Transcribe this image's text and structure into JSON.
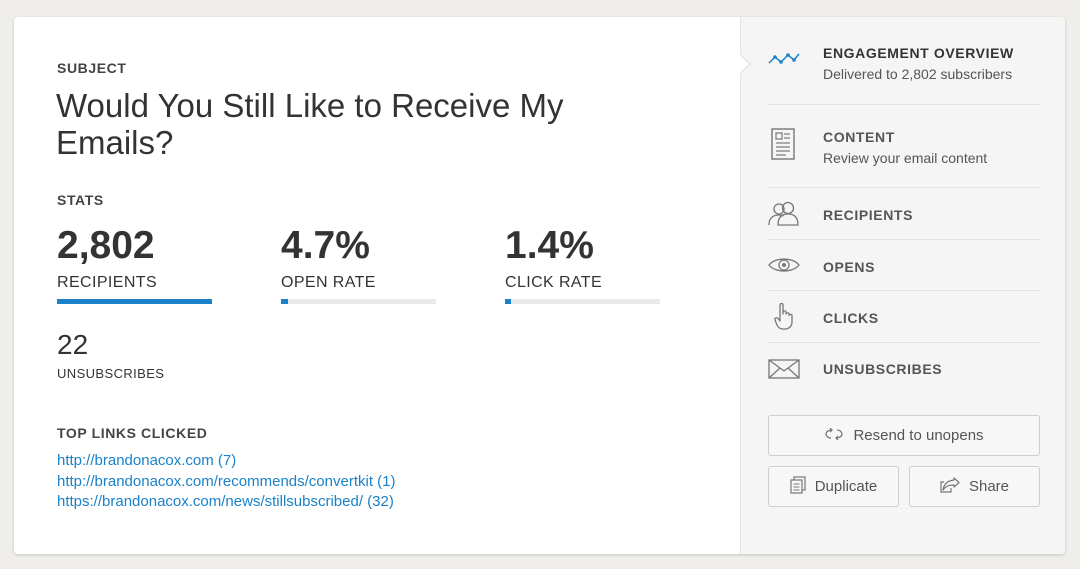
{
  "subject": {
    "label": "SUBJECT",
    "title": "Would You Still Like to Receive My Emails?"
  },
  "stats": {
    "label": "STATS",
    "items": [
      {
        "value": "2,802",
        "label": "RECIPIENTS",
        "progress": 1.0
      },
      {
        "value": "4.7%",
        "label": "OPEN RATE",
        "progress": 0.047
      },
      {
        "value": "1.4%",
        "label": "CLICK RATE",
        "progress": 0.04
      }
    ],
    "unsubscribes": {
      "value": "22",
      "label": "UNSUBSCRIBES"
    }
  },
  "top_links": {
    "label": "TOP LINKS CLICKED",
    "items": [
      "http://brandonacox.com (7)",
      "http://brandonacox.com/recommends/convertkit (1)",
      "https://brandonacox.com/news/stillsubscribed/ (32)"
    ]
  },
  "sidebar": {
    "items": [
      {
        "title": "ENGAGEMENT OVERVIEW",
        "subtitle": "Delivered to 2,802 subscribers",
        "icon": "line-chart-icon"
      },
      {
        "title": "CONTENT",
        "subtitle": "Review your email content",
        "icon": "document-icon"
      },
      {
        "title": "RECIPIENTS",
        "icon": "people-icon"
      },
      {
        "title": "OPENS",
        "icon": "eye-icon"
      },
      {
        "title": "CLICKS",
        "icon": "pointer-hand-icon"
      },
      {
        "title": "UNSUBSCRIBES",
        "icon": "envelope-icon"
      }
    ],
    "buttons": {
      "resend": "Resend to unopens",
      "duplicate": "Duplicate",
      "share": "Share"
    }
  },
  "colors": {
    "accent": "#1a82c8",
    "background": "#efeeea",
    "sidebar": "#f5f5f5"
  }
}
